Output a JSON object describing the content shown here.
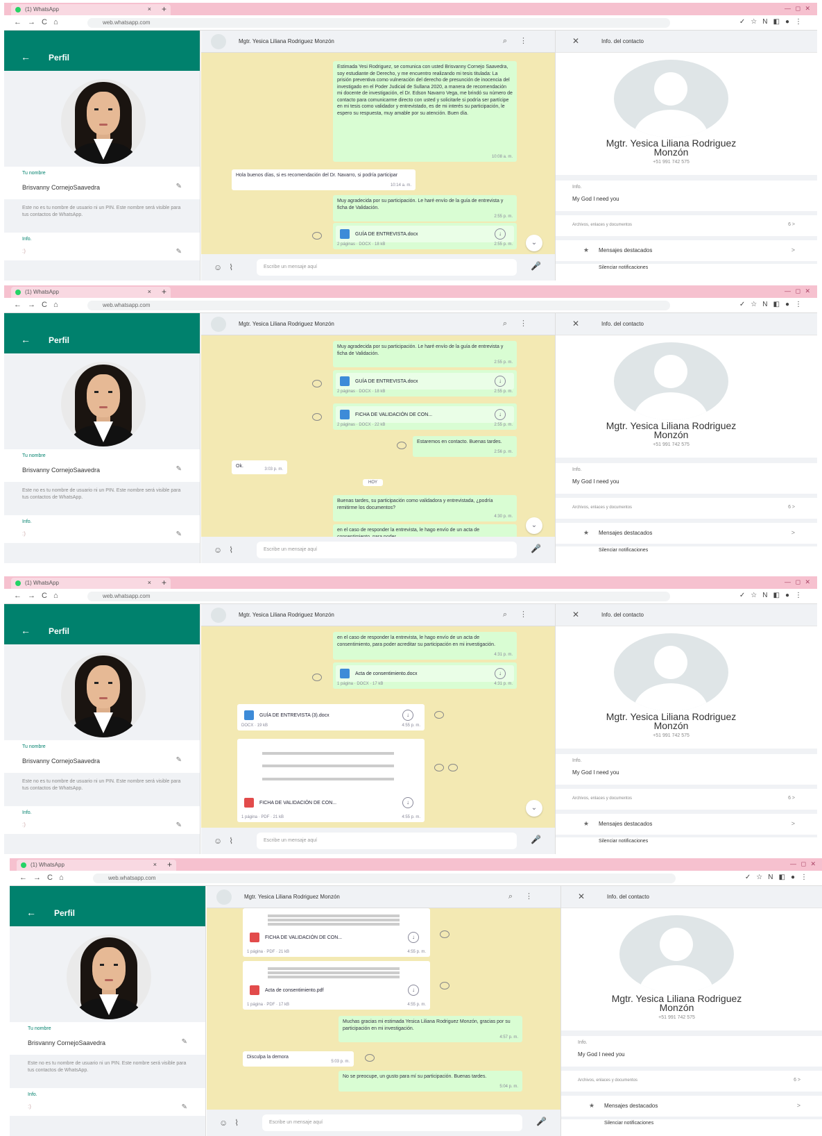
{
  "browser": {
    "tab_title": "(1) WhatsApp",
    "url": "web.whatsapp.com",
    "tab_close": "×",
    "tab_new": "+",
    "nav_icons": [
      "←",
      "→",
      "C",
      "⌂"
    ],
    "extension_icons": [
      "✓",
      "☆",
      "N",
      "◧",
      "●",
      "⋮"
    ],
    "window_controls": "—  ◻  ✕"
  },
  "profile": {
    "header_title": "Perfil",
    "back_icon": "←",
    "name_label": "Tu nombre",
    "name_value": "Brisvanny CornejoSaavedra",
    "name_note": "Este no es tu nombre de usuario ni un PIN. Este nombre será visible para tus contactos de WhatsApp.",
    "info_label": "Info.",
    "info_value": ":)",
    "edit_icon": "✎"
  },
  "chat": {
    "contact_name": "Mgtr. Yesica Liliana Rodriguez Monzón",
    "search_icon": "⌕",
    "menu_icon": "⋮",
    "input_placeholder": "Escribe un mensaje aquí",
    "emoji_icon": "☺",
    "attach_icon": "⌇",
    "mic_icon": "🎤",
    "scroll_icon": "⌄",
    "download_icon": "↓",
    "screens": [
      {
        "messages": [
          {
            "text": "Estimada Yesi Rodriguez, se comunica con usted Brisvanny Cornejo Saavedra, soy estudiante de Derecho, y me encuentro realizando mi tesis titulada: La prisión preventiva como vulneración del derecho de presunción de inocencia del investigado en el Poder Judicial de Sullana 2020, a manera de recomendación mi docente de investigación, el Dr. Edson Navarro Vega, me brindó su número de contacto para comunicarme directo con usted y solicitarle si podría ser partícipe en mi tesis como validador y entrevistado, es de mi interés su participación, le espero su respuesta, muy amable por su atención. Buen día.",
            "time": "10:08 a. m."
          },
          {
            "text": "Hola buenos días, si es recomendación del Dr. Navarro, si podría participar",
            "time": "10:14 a. m."
          },
          {
            "text": "Muy agradecida por su participación. Le haré envío de la guía de entrevista y ficha de Validación.",
            "time": "2:55 p. m."
          },
          {
            "file": "GUÍA DE ENTREVISTA.docx",
            "meta": "2 páginas · DOCX · 18 kB",
            "time": "2:55 p. m."
          }
        ]
      },
      {
        "messages": [
          {
            "text": "Muy agradecida por su participación. Le haré envío de la guía de entrevista y ficha de Validación.",
            "time": "2:55 p. m."
          },
          {
            "file": "GUÍA DE ENTREVISTA.docx",
            "meta": "2 páginas · DOCX · 18 kB",
            "time": "2:55 p. m."
          },
          {
            "file": "FICHA DE VALIDACIÓN DE CON...",
            "meta": "2 páginas · DOCX · 22 kB",
            "time": "2:55 p. m."
          },
          {
            "text": "Estaremos en contacto. Buenas tardes.",
            "time": "2:56 p. m."
          },
          {
            "text": "Ok.",
            "time": "3:03 p. m."
          },
          {
            "pill": "HOY"
          },
          {
            "text": "Buenas tardes, su participación como validadora y entrevistada, ¿podría remitirme los documentos?",
            "time": "4:30 p. m."
          },
          {
            "text": "en el caso de responder la entrevista, le hago envío de un acta de consentimiento, para poder",
            "time": ""
          }
        ]
      },
      {
        "messages": [
          {
            "text": "en el caso de responder la entrevista, le hago envío de un acta de consentimiento, para poder acreditar su participación en mi investigación.",
            "time": "4:31 p. m."
          },
          {
            "file": "Acta de consentimiento.docx",
            "meta": "1 página · DOCX · 17 kB",
            "time": "4:31 p. m."
          },
          {
            "file": "GUÍA DE ENTREVISTA (3).docx",
            "meta": "DOCX · 19 kB",
            "time": "4:55 p. m."
          },
          {
            "file": "FICHA DE VALIDACIÓN DE CON...",
            "meta": "1 página · PDF · 21 kB",
            "time": "4:55 p. m."
          }
        ]
      },
      {
        "messages": [
          {
            "file": "FICHA DE VALIDACIÓN DE CON...",
            "meta": "1 página · PDF · 21 kB",
            "time": "4:55 p. m."
          },
          {
            "file": "Acta de consentimiento.pdf",
            "meta": "1 página · PDF · 17 kB",
            "time": "4:55 p. m."
          },
          {
            "text": "Muchas gracias mi estimada Yesica Liliana Rodriguez Monzón, gracias por su participación en mi investigación.",
            "time": "4:57 p. m."
          },
          {
            "text": "Disculpa la demora",
            "time": "5:03 p. m."
          },
          {
            "text": "No se preocupe, un gusto para mí su participación. Buenas tardes.",
            "time": "5:04 p. m."
          }
        ]
      }
    ]
  },
  "contact_info": {
    "close_icon": "✕",
    "title": "Info. del contacto",
    "name_line1": "Mgtr. Yesica Liliana Rodriguez",
    "name_line2": "Monzón",
    "phone": "+51 991 742 575",
    "info_label": "Info.",
    "info_value": "My God I need you",
    "files_label": "Archivos, enlaces y documentos",
    "files_count": "6 >",
    "starred_icon": "★",
    "starred_label": "Mensajes destacados",
    "starred_chevron": ">",
    "mute_label": "Silenciar notificaciones"
  }
}
